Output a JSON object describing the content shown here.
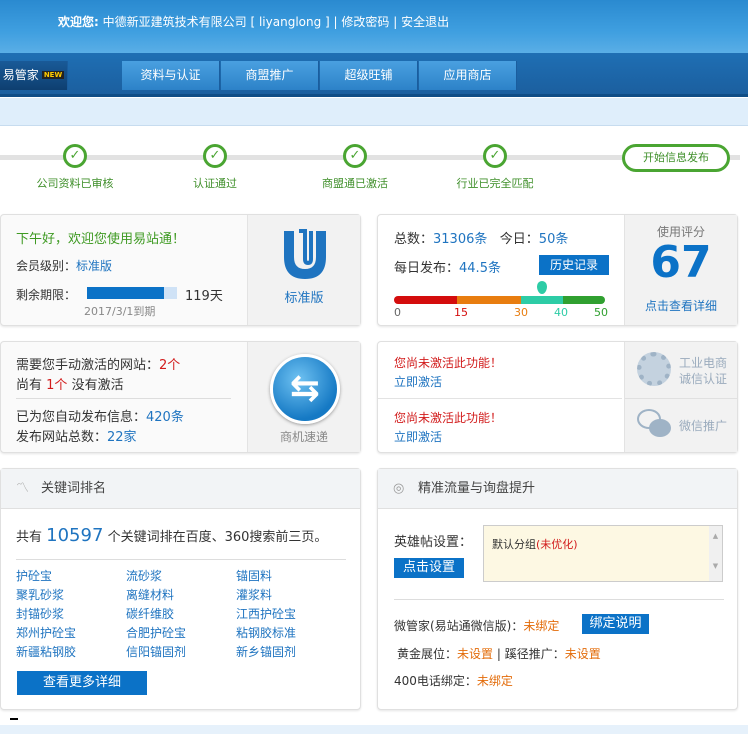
{
  "header": {
    "welcome_label": "欢迎您:",
    "company": "中德新亚建筑技术有限公司",
    "username": "liyanglong",
    "change_password": "修改密码",
    "logout": "安全退出"
  },
  "nav": {
    "tabs": [
      {
        "label": "易管家",
        "badge": "NEW"
      },
      {
        "label": "资料与认证"
      },
      {
        "label": "商盟推广"
      },
      {
        "label": "超级旺铺"
      },
      {
        "label": "应用商店"
      }
    ]
  },
  "steps": {
    "items": [
      "公司资料已审核",
      "认证通过",
      "商盟通已激活",
      "行业已完全匹配"
    ],
    "start_button": "开始信息发布"
  },
  "account": {
    "greeting": "下午好，欢迎您使用易站通！",
    "level_label": "会员级别：",
    "level": "标准版",
    "remaining_label": "剩余期限：",
    "remaining_fraction": 0.85,
    "remaining_days": "119天",
    "expiry": "2017/3/1到期",
    "badge_label": "标准版"
  },
  "stats": {
    "total_label": "总数：",
    "total": "31306条",
    "today_label": "今日：",
    "today": "50条",
    "daily_label": "每日发布：",
    "daily": "44.5条",
    "history_button": "历史记录",
    "gauge_value": 35,
    "gauge_ticks": [
      "0",
      "15",
      "30",
      "40",
      "50"
    ],
    "score_label": "使用评分",
    "score": "67",
    "score_link": "点击查看详细",
    "colors": {
      "red": "#d40d0d",
      "orange": "#e87d10",
      "teal": "#2dcca6",
      "green": "#30a030"
    }
  },
  "activation": {
    "manual_label": "需要您手动激活的网站：",
    "manual_count": "2个",
    "not_active_prefix": "尚有",
    "not_active_count": "1个",
    "not_active_suffix": "没有激活",
    "auto_label": "已为您自动发布信息：",
    "auto_count": "420条",
    "sites_label": "发布网站总数：",
    "sites_count": "22家",
    "icon_label": "商机速递"
  },
  "features": [
    {
      "warning": "您尚未激活此功能！",
      "link": "立即激活",
      "name_line1": "工业电商",
      "name_line2": "诚信认证"
    },
    {
      "warning": "您尚未激活此功能！",
      "link": "立即激活",
      "name": "微信推广"
    }
  ],
  "keywords": {
    "title": "关键词排名",
    "summary_prefix": "共有",
    "count": "10597",
    "summary_suffix": "个关键词排在百度、360搜索前三页。",
    "items": [
      "护砼宝",
      "流砂浆",
      "锚固料",
      "聚乳砂浆",
      "离缝材料",
      "灌浆料",
      "封锚砂浆",
      "碳纤维胶",
      "江西护砼宝",
      "郑州护砼宝",
      "合肥护砼宝",
      "粘钢胶标准",
      "新疆粘钢胶",
      "信阳锚固剂",
      "新乡锚固剂"
    ],
    "more_button": "查看更多详细"
  },
  "traffic": {
    "title": "精准流量与询盘提升",
    "hero_label": "英雄帖设置：",
    "set_button": "点击设置",
    "group_text": "默认分组",
    "group_status": "(未优化)",
    "wechat_label": "微管家(易站通微信版)：",
    "wechat_status": "未绑定",
    "bind_button": "绑定说明",
    "gold_label": "黄金展位：",
    "gold_status": "未设置",
    "sep": "|",
    "path_label": "蹊径推广：",
    "path_status": "未设置",
    "phone_label": "400电话绑定：",
    "phone_status": "未绑定"
  }
}
